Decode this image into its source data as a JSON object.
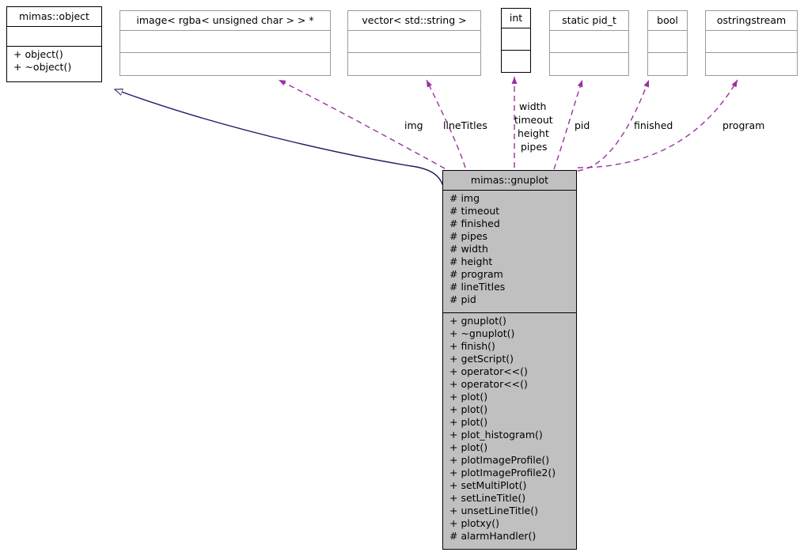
{
  "diagram": {
    "title": "mimas::gnuplot collaboration diagram",
    "colors": {
      "inheritance_edge": "#1a1a64",
      "usage_edge": "#9a32a0",
      "class_fill": "#c0c0c0",
      "box_border_gray": "#9a9a9a",
      "box_border_black": "#000000",
      "text": "#000000",
      "background": "#ffffff"
    }
  },
  "classes": {
    "object": {
      "name": "mimas::object",
      "attributes": [],
      "methods": [
        "+ object()",
        "+ ~object()"
      ],
      "style": "dark"
    },
    "image": {
      "name": "image< rgba< unsigned char > > *",
      "attributes": [],
      "methods": [],
      "style": "gray"
    },
    "vector_string": {
      "name": "vector< std::string >",
      "attributes": [],
      "methods": [],
      "style": "gray"
    },
    "int_type": {
      "name": "int",
      "attributes": [],
      "methods": [],
      "style": "dark"
    },
    "pid_type": {
      "name": "static pid_t",
      "attributes": [],
      "methods": [],
      "style": "gray"
    },
    "bool_type": {
      "name": "bool",
      "attributes": [],
      "methods": [],
      "style": "gray"
    },
    "ostringstream": {
      "name": "ostringstream",
      "attributes": [],
      "methods": [],
      "style": "gray"
    },
    "gnuplot": {
      "name": "mimas::gnuplot",
      "attributes": [
        "# img",
        "# timeout",
        "# finished",
        "# pipes",
        "# width",
        "# height",
        "# program",
        "# lineTitles",
        "# pid"
      ],
      "methods": [
        "+ gnuplot()",
        "+ ~gnuplot()",
        "+ finish()",
        "+ getScript()",
        "+ operator<<()",
        "+ operator<<()",
        "+ plot()",
        "+ plot()",
        "+ plot()",
        "+ plot_histogram()",
        "+ plot()",
        "+ plotImageProfile()",
        "+ plotImageProfile2()",
        "+ setMultiPlot()",
        "+ setLineTitle()",
        "+ unsetLineTitle()",
        "+ plotxy()",
        "# alarmHandler()"
      ],
      "style": "filled"
    }
  },
  "edge_labels": {
    "img": "img",
    "lineTitles": "lineTitles",
    "width": "width",
    "timeout": "timeout",
    "height": "height",
    "pipes": "pipes",
    "pid": "pid",
    "finished": "finished",
    "program": "program"
  }
}
